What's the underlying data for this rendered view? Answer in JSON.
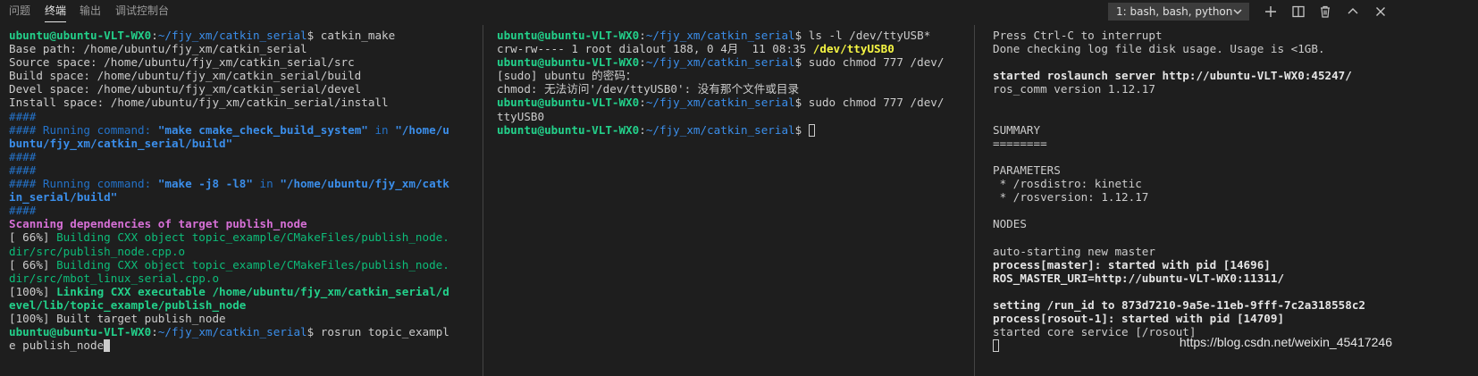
{
  "tabs": [
    {
      "label": "问题"
    },
    {
      "label": "终端"
    },
    {
      "label": "输出"
    },
    {
      "label": "调试控制台"
    }
  ],
  "terminal_select": {
    "value": "1: bash, bash, python"
  },
  "toolbar_icons": [
    "plus-icon",
    "split-icon",
    "trash-icon",
    "chevron-up-icon",
    "close-icon"
  ],
  "pane1": [
    [
      [
        "g",
        "ubuntu@ubuntu-VLT-WX0"
      ],
      [
        "w",
        ":"
      ],
      [
        "b",
        "~/fjy_xm/catkin_serial"
      ],
      [
        "w",
        "$ catkin_make"
      ]
    ],
    [
      [
        "w",
        "Base path: /home/ubuntu/fjy_xm/catkin_serial"
      ]
    ],
    [
      [
        "w",
        "Source space: /home/ubuntu/fjy_xm/catkin_serial/src"
      ]
    ],
    [
      [
        "w",
        "Build space: /home/ubuntu/fjy_xm/catkin_serial/build"
      ]
    ],
    [
      [
        "w",
        "Devel space: /home/ubuntu/fjy_xm/catkin_serial/devel"
      ]
    ],
    [
      [
        "w",
        "Install space: /home/ubuntu/fjy_xm/catkin_serial/install"
      ]
    ],
    [
      [
        "c",
        "####"
      ]
    ],
    [
      [
        "c",
        "#### Running command: "
      ],
      [
        "cb",
        "\"make cmake_check_build_system\""
      ],
      [
        "c",
        " in "
      ],
      [
        "cb",
        "\"/home/u"
      ]
    ],
    [
      [
        "cb",
        "buntu/fjy_xm/catkin_serial/build\""
      ]
    ],
    [
      [
        "c",
        "####"
      ]
    ],
    [
      [
        "c",
        "####"
      ]
    ],
    [
      [
        "c",
        "#### Running command: "
      ],
      [
        "cb",
        "\"make -j8 -l8\""
      ],
      [
        "c",
        " in "
      ],
      [
        "cb",
        "\"/home/ubuntu/fjy_xm/catk"
      ]
    ],
    [
      [
        "cb",
        "in_serial/build\""
      ]
    ],
    [
      [
        "c",
        "####"
      ]
    ],
    [
      [
        "m",
        "Scanning dependencies of target publish_node"
      ]
    ],
    [
      [
        "w",
        "[ 66%] "
      ],
      [
        "gn",
        "Building CXX object topic_example/CMakeFiles/publish_node."
      ]
    ],
    [
      [
        "gn",
        "dir/src/publish_node.cpp.o"
      ]
    ],
    [
      [
        "w",
        "[ 66%] "
      ],
      [
        "gn",
        "Building CXX object topic_example/CMakeFiles/publish_node."
      ]
    ],
    [
      [
        "gn",
        "dir/src/mbot_linux_serial.cpp.o"
      ]
    ],
    [
      [
        "w",
        "[100%] "
      ],
      [
        "gnb",
        "Linking CXX executable /home/ubuntu/fjy_xm/catkin_serial/d"
      ]
    ],
    [
      [
        "gnb",
        "evel/lib/topic_example/publish_node"
      ]
    ],
    [
      [
        "w",
        "[100%] Built target publish_node"
      ]
    ],
    [
      [
        "g",
        "ubuntu@ubuntu-VLT-WX0"
      ],
      [
        "w",
        ":"
      ],
      [
        "b",
        "~/fjy_xm/catkin_serial"
      ],
      [
        "w",
        "$ rosrun topic_exampl"
      ]
    ],
    [
      [
        "w",
        "e publish_node"
      ],
      [
        "cursorfill",
        ""
      ]
    ]
  ],
  "pane2": [
    [
      [
        "g",
        "ubuntu@ubuntu-VLT-WX0"
      ],
      [
        "w",
        ":"
      ],
      [
        "b",
        "~/fjy_xm/catkin_serial"
      ],
      [
        "w",
        "$ ls -l /dev/ttyUSB*"
      ]
    ],
    [
      [
        "w",
        "crw-rw---- 1 root dialout 188, 0 4月  11 08:35 "
      ],
      [
        "y",
        "/dev/ttyUSB0"
      ]
    ],
    [
      [
        "g",
        "ubuntu@ubuntu-VLT-WX0"
      ],
      [
        "w",
        ":"
      ],
      [
        "b",
        "~/fjy_xm/catkin_serial"
      ],
      [
        "w",
        "$ sudo chmod 777 /dev/"
      ]
    ],
    [
      [
        "w",
        "[sudo] ubuntu 的密码："
      ]
    ],
    [
      [
        "w",
        "chmod: 无法访问'/dev/ttyUSB0': 没有那个文件或目录"
      ]
    ],
    [
      [
        "g",
        "ubuntu@ubuntu-VLT-WX0"
      ],
      [
        "w",
        ":"
      ],
      [
        "b",
        "~/fjy_xm/catkin_serial"
      ],
      [
        "w",
        "$ sudo chmod 777 /dev/"
      ]
    ],
    [
      [
        "w",
        "ttyUSB0"
      ]
    ],
    [
      [
        "g",
        "ubuntu@ubuntu-VLT-WX0"
      ],
      [
        "w",
        ":"
      ],
      [
        "b",
        "~/fjy_xm/catkin_serial"
      ],
      [
        "w",
        "$ "
      ],
      [
        "cursorbox",
        ""
      ]
    ]
  ],
  "pane3": [
    [
      [
        "w",
        "Press Ctrl-C to interrupt"
      ]
    ],
    [
      [
        "w",
        "Done checking log file disk usage. Usage is <1GB."
      ]
    ],
    [
      [
        "w",
        ""
      ]
    ],
    [
      [
        "bw",
        "started roslaunch server http://ubuntu-VLT-WX0:45247/"
      ]
    ],
    [
      [
        "w",
        "ros_comm version 1.12.17"
      ]
    ],
    [
      [
        "w",
        ""
      ]
    ],
    [
      [
        "w",
        ""
      ]
    ],
    [
      [
        "w",
        "SUMMARY"
      ]
    ],
    [
      [
        "w",
        "========"
      ]
    ],
    [
      [
        "w",
        ""
      ]
    ],
    [
      [
        "w",
        "PARAMETERS"
      ]
    ],
    [
      [
        "w",
        " * /rosdistro: kinetic"
      ]
    ],
    [
      [
        "w",
        " * /rosversion: 1.12.17"
      ]
    ],
    [
      [
        "w",
        ""
      ]
    ],
    [
      [
        "w",
        "NODES"
      ]
    ],
    [
      [
        "w",
        ""
      ]
    ],
    [
      [
        "w",
        "auto-starting new master"
      ]
    ],
    [
      [
        "bw",
        "process[master]: started with pid [14696]"
      ]
    ],
    [
      [
        "bw",
        "ROS_MASTER_URI=http://ubuntu-VLT-WX0:11311/"
      ]
    ],
    [
      [
        "w",
        ""
      ]
    ],
    [
      [
        "bw",
        "setting /run_id to 873d7210-9a5e-11eb-9fff-7c2a318558c2"
      ]
    ],
    [
      [
        "bw",
        "process[rosout-1]: started with pid [14709]"
      ]
    ],
    [
      [
        "w",
        "started core service [/rosout]"
      ]
    ],
    [
      [
        "cursorbox",
        ""
      ]
    ]
  ],
  "watermark": "https://blog.csdn.net/weixin_45417246"
}
